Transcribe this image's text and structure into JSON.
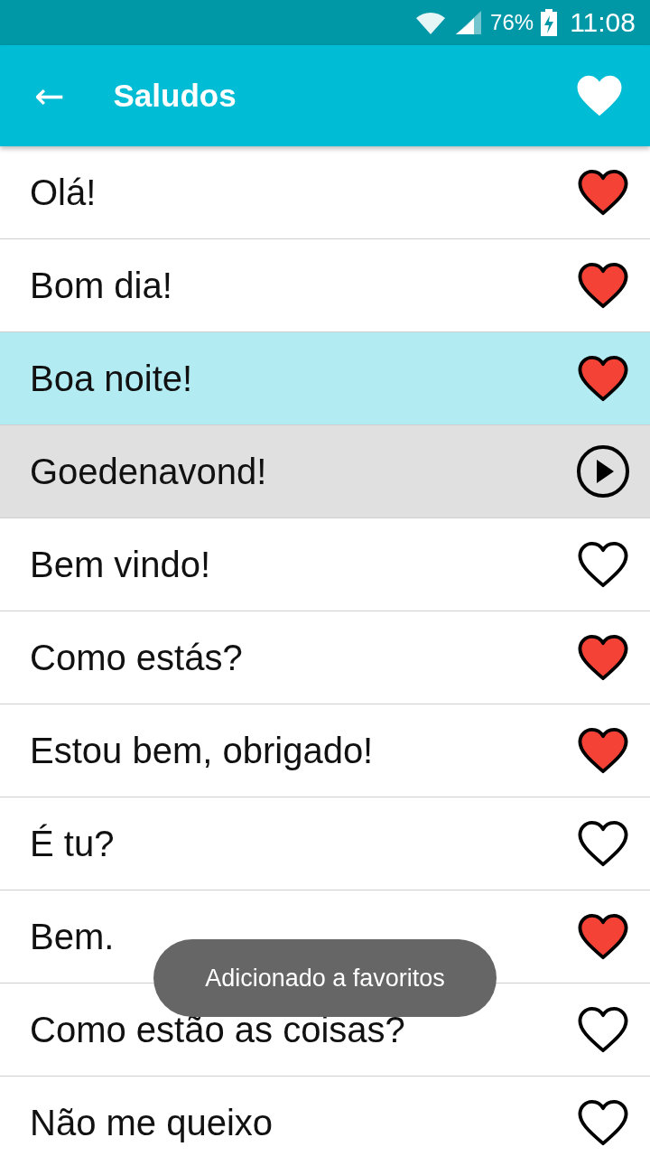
{
  "status_bar": {
    "battery": "76%",
    "time": "11:08"
  },
  "app_bar": {
    "back_icon": "←",
    "title": "Saludos"
  },
  "phrases": [
    {
      "text": "Olá!",
      "kind": "heart",
      "favorite": true,
      "selected": false
    },
    {
      "text": "Bom dia!",
      "kind": "heart",
      "favorite": true,
      "selected": false
    },
    {
      "text": "Boa noite!",
      "kind": "heart",
      "favorite": true,
      "selected": true
    },
    {
      "text": "Goedenavond!",
      "kind": "play",
      "selected": false
    },
    {
      "text": "Bem vindo!",
      "kind": "heart",
      "favorite": false,
      "selected": false
    },
    {
      "text": "Como estás?",
      "kind": "heart",
      "favorite": true,
      "selected": false
    },
    {
      "text": "Estou bem, obrigado!",
      "kind": "heart",
      "favorite": true,
      "selected": false
    },
    {
      "text": "É tu?",
      "kind": "heart",
      "favorite": false,
      "selected": false
    },
    {
      "text": "Bem.",
      "kind": "heart",
      "favorite": true,
      "selected": false
    },
    {
      "text": "Como estão as coisas?",
      "kind": "heart",
      "favorite": false,
      "selected": false
    },
    {
      "text": "Não me queixo",
      "kind": "heart",
      "favorite": false,
      "selected": false
    }
  ],
  "toast": "Adicionado a favoritos"
}
